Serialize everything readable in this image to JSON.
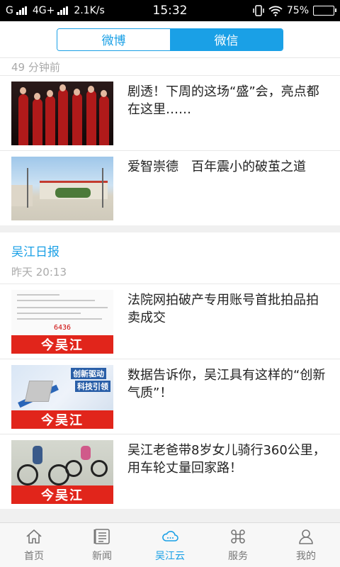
{
  "status_bar": {
    "carrier": "G",
    "network": "4G+",
    "speed": "2.1K/s",
    "time": "15:32",
    "battery": "75%",
    "battery_level": 0.75
  },
  "segment": {
    "tabs": [
      {
        "label": "微博",
        "active": false
      },
      {
        "label": "微信",
        "active": true
      }
    ]
  },
  "feed": {
    "group1": {
      "time": "49 分钟前",
      "items": [
        {
          "title": "剧透！下周的这场“盛”会，亮点都在这里……"
        },
        {
          "title": "爱智崇德　百年震小的破茧之道"
        }
      ]
    },
    "group2": {
      "source": "吴江日报",
      "time": "昨天 20:13",
      "items": [
        {
          "title": "法院网拍破产专用账号首批拍品拍卖成交",
          "thumb_text": "今吴江",
          "doc_number": "6436"
        },
        {
          "title": "数据告诉你，吴江具有这样的“创新气质”！",
          "thumb_text": "今吴江",
          "thumb_caption1": "创新驱动",
          "thumb_caption2": "科技引领"
        },
        {
          "title": "吴江老爸带8岁女儿骑行360公里，用车轮丈量回家路！",
          "thumb_text": "今吴江"
        }
      ]
    }
  },
  "tabbar": {
    "items": [
      {
        "label": "首页",
        "icon": "home-icon",
        "active": false
      },
      {
        "label": "新闻",
        "icon": "news-icon",
        "active": false
      },
      {
        "label": "吴江云",
        "icon": "cloud-icon",
        "active": true
      },
      {
        "label": "服务",
        "icon": "service-icon",
        "active": false
      },
      {
        "label": "我的",
        "icon": "user-icon",
        "active": false
      }
    ]
  },
  "colors": {
    "accent": "#1aa0e6",
    "brand_red": "#e1251b"
  }
}
